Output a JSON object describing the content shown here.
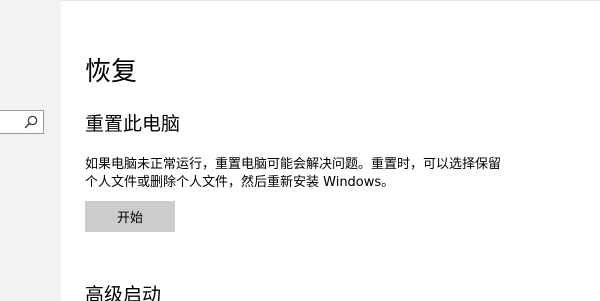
{
  "page": {
    "title": "恢复"
  },
  "search": {
    "icon": "search-icon"
  },
  "reset_section": {
    "heading": "重置此电脑",
    "description_line1": "如果电脑未正常运行，重置电脑可能会解决问题。重置时，可以选择保留",
    "description_line2": "个人文件或删除个人文件，然后重新安装 Windows。",
    "start_label": "开始"
  },
  "advanced_section": {
    "heading": "高级启动"
  },
  "colors": {
    "sidebar_bg": "#f2f2f2",
    "button_bg": "#cccccc",
    "text": "#000000"
  }
}
